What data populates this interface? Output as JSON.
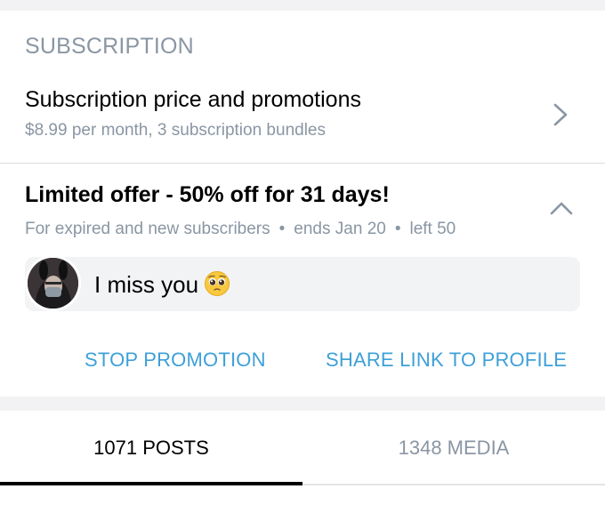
{
  "section": {
    "title": "SUBSCRIPTION"
  },
  "subscription_row": {
    "title": "Subscription price and promotions",
    "description": "$8.99 per month, 3 subscription bundles",
    "icon": "chevron-right-icon"
  },
  "offer": {
    "title": "Limited offer - 50% off for 31 days!",
    "audience": "For expired and new subscribers",
    "ends": "ends Jan 20",
    "left": "left 50",
    "separator": "•",
    "toggle_icon": "chevron-up-icon"
  },
  "message": {
    "text": "I miss you",
    "emoji_icon": "pleading-face-emoji-icon"
  },
  "actions": {
    "stop": "STOP PROMOTION",
    "share": "SHARE LINK TO PROFILE"
  },
  "tabs": [
    {
      "label": "1071 POSTS",
      "active": true
    },
    {
      "label": "1348 MEDIA",
      "active": false
    }
  ],
  "colors": {
    "accent": "#3ea0d8",
    "muted": "#8a96a3",
    "background": "#f2f2f4"
  }
}
